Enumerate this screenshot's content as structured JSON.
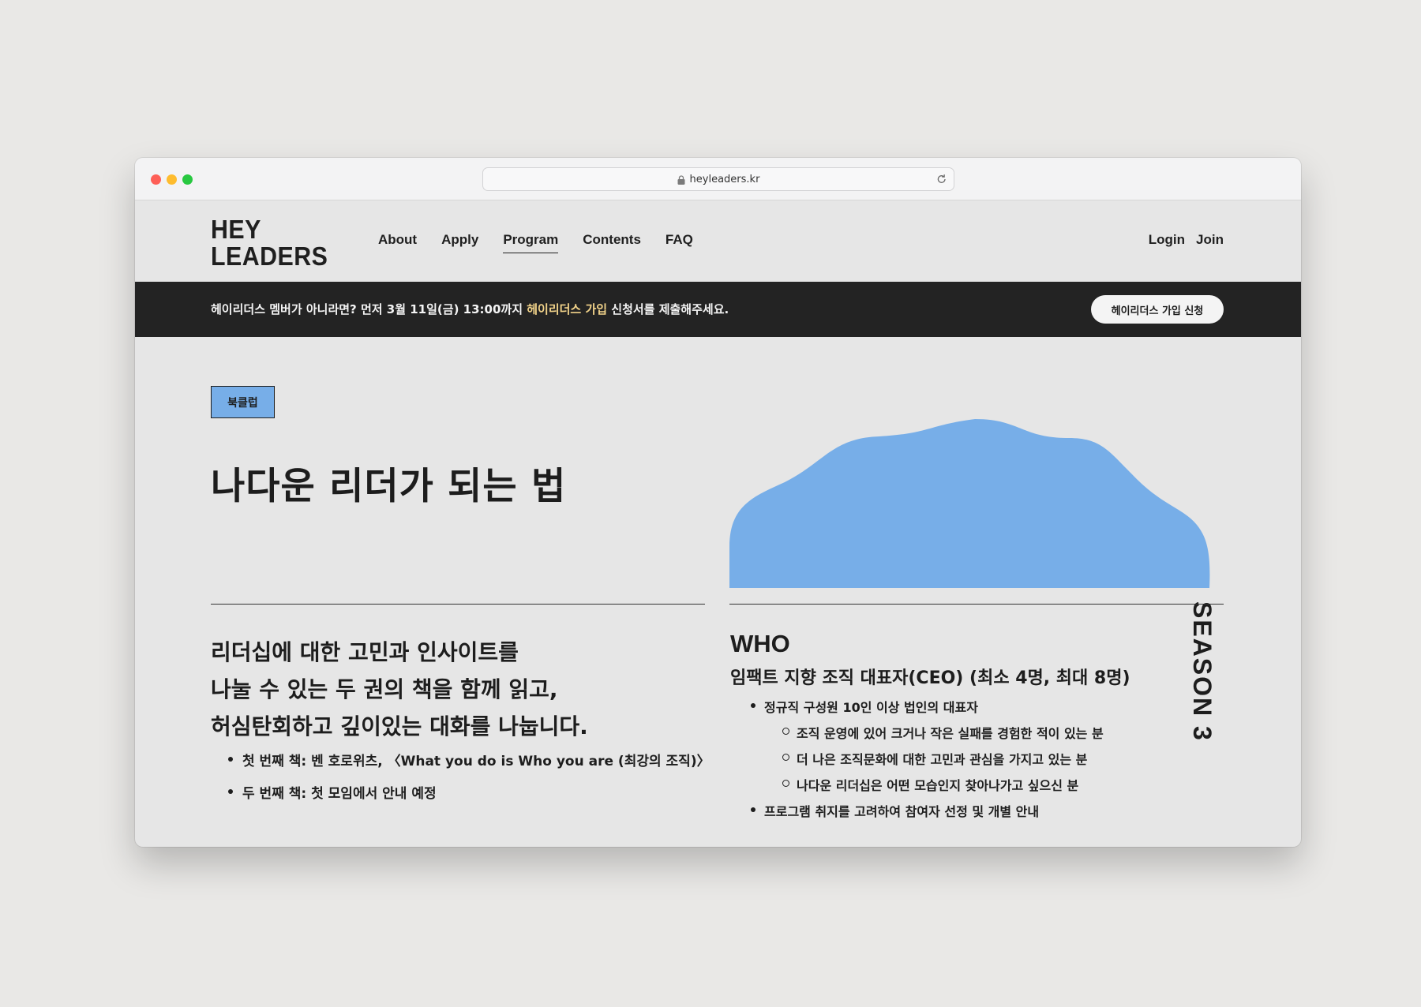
{
  "browser": {
    "url": "heyleaders.kr"
  },
  "header": {
    "logo_line1": "HEY",
    "logo_line2": "LEADERS",
    "nav": [
      {
        "label": "About"
      },
      {
        "label": "Apply"
      },
      {
        "label": "Program"
      },
      {
        "label": "Contents"
      },
      {
        "label": "FAQ"
      }
    ],
    "active_nav": "Program",
    "login": "Login",
    "join": "Join"
  },
  "banner": {
    "text_before": "헤이리더스 멤버가 아니라면? 먼저 3월 11일(금) 13:00까지 ",
    "highlight": "헤이리더스 가입",
    "text_after": " 신청서를 제출해주세요.",
    "button": "헤이리더스 가입 신청",
    "highlight_color": "#f2d38a"
  },
  "program": {
    "tag": "북클럽",
    "title": "나다운 리더가 되는 법",
    "season": "SEASON 3",
    "accent_color": "#77aee8",
    "lead": [
      "리더십에 대한 고민과 인사이트를",
      "나눌 수 있는 두 권의 책을 함께 읽고,",
      "허심탄회하고 깊이있는 대화를 나눕니다."
    ],
    "books": [
      "첫 번째 책: 벤 호로위츠, 〈What you do is Who you are (최강의 조직)〉",
      "두 번째 책: 첫 모임에서 안내 예정"
    ]
  },
  "who": {
    "heading": "WHO",
    "subtitle": "임팩트 지향 조직 대표자(CEO) (최소 4명, 최대 8명)",
    "items": [
      "정규직 구성원 10인 이상 법인의 대표자",
      "조직 운영에 있어 크거나 작은 실패를 경험한 적이 있는 분",
      "더 나은 조직문화에 대한 고민과 관심을 가지고 있는 분",
      "나다운 리더십은 어떤 모습인지 찾아나가고 싶으신 분",
      "프로그램 취지를 고려하여 참여자 선정 및 개별 안내"
    ]
  }
}
